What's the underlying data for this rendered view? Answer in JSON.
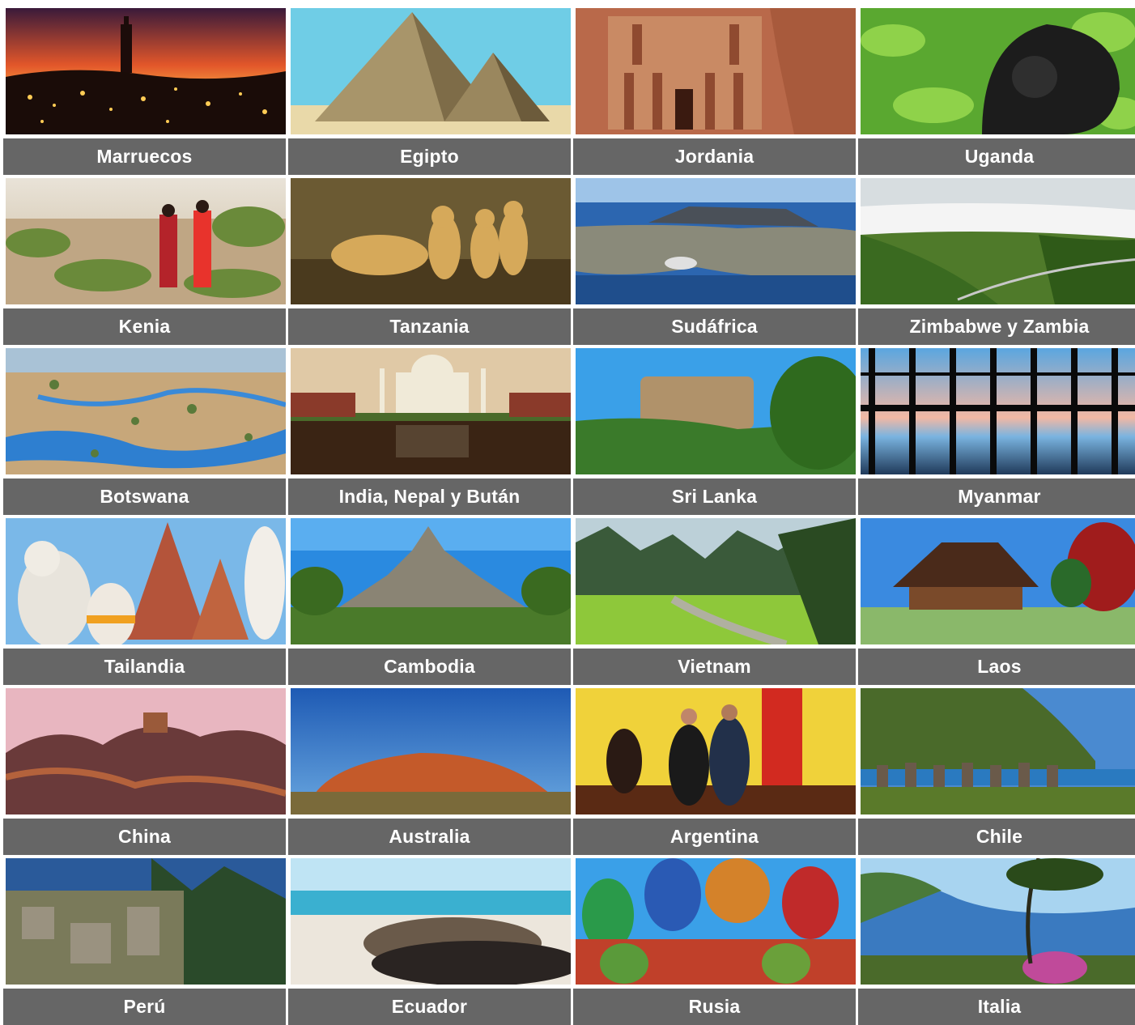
{
  "destinations": [
    {
      "label": "Marruecos",
      "scene": "marruecos"
    },
    {
      "label": "Egipto",
      "scene": "egipto"
    },
    {
      "label": "Jordania",
      "scene": "jordania"
    },
    {
      "label": "Uganda",
      "scene": "uganda"
    },
    {
      "label": "Kenia",
      "scene": "kenia"
    },
    {
      "label": "Tanzania",
      "scene": "tanzania"
    },
    {
      "label": "Sudáfrica",
      "scene": "sudafrica"
    },
    {
      "label": "Zimbabwe y Zambia",
      "scene": "zimbabwe"
    },
    {
      "label": "Botswana",
      "scene": "botswana"
    },
    {
      "label": "India, Nepal y Bután",
      "scene": "india"
    },
    {
      "label": "Sri Lanka",
      "scene": "srilanka"
    },
    {
      "label": "Myanmar",
      "scene": "myanmar"
    },
    {
      "label": "Tailandia",
      "scene": "tailandia"
    },
    {
      "label": "Cambodia",
      "scene": "cambodia"
    },
    {
      "label": "Vietnam",
      "scene": "vietnam"
    },
    {
      "label": "Laos",
      "scene": "laos"
    },
    {
      "label": "China",
      "scene": "china"
    },
    {
      "label": "Australia",
      "scene": "australia"
    },
    {
      "label": "Argentina",
      "scene": "argentina"
    },
    {
      "label": "Chile",
      "scene": "chile"
    },
    {
      "label": "Perú",
      "scene": "peru"
    },
    {
      "label": "Ecuador",
      "scene": "ecuador"
    },
    {
      "label": "Rusia",
      "scene": "rusia"
    },
    {
      "label": "Italia",
      "scene": "italia"
    }
  ],
  "colors": {
    "label_background": "#666666",
    "label_text": "#ffffff",
    "page_background": "#ffffff"
  }
}
